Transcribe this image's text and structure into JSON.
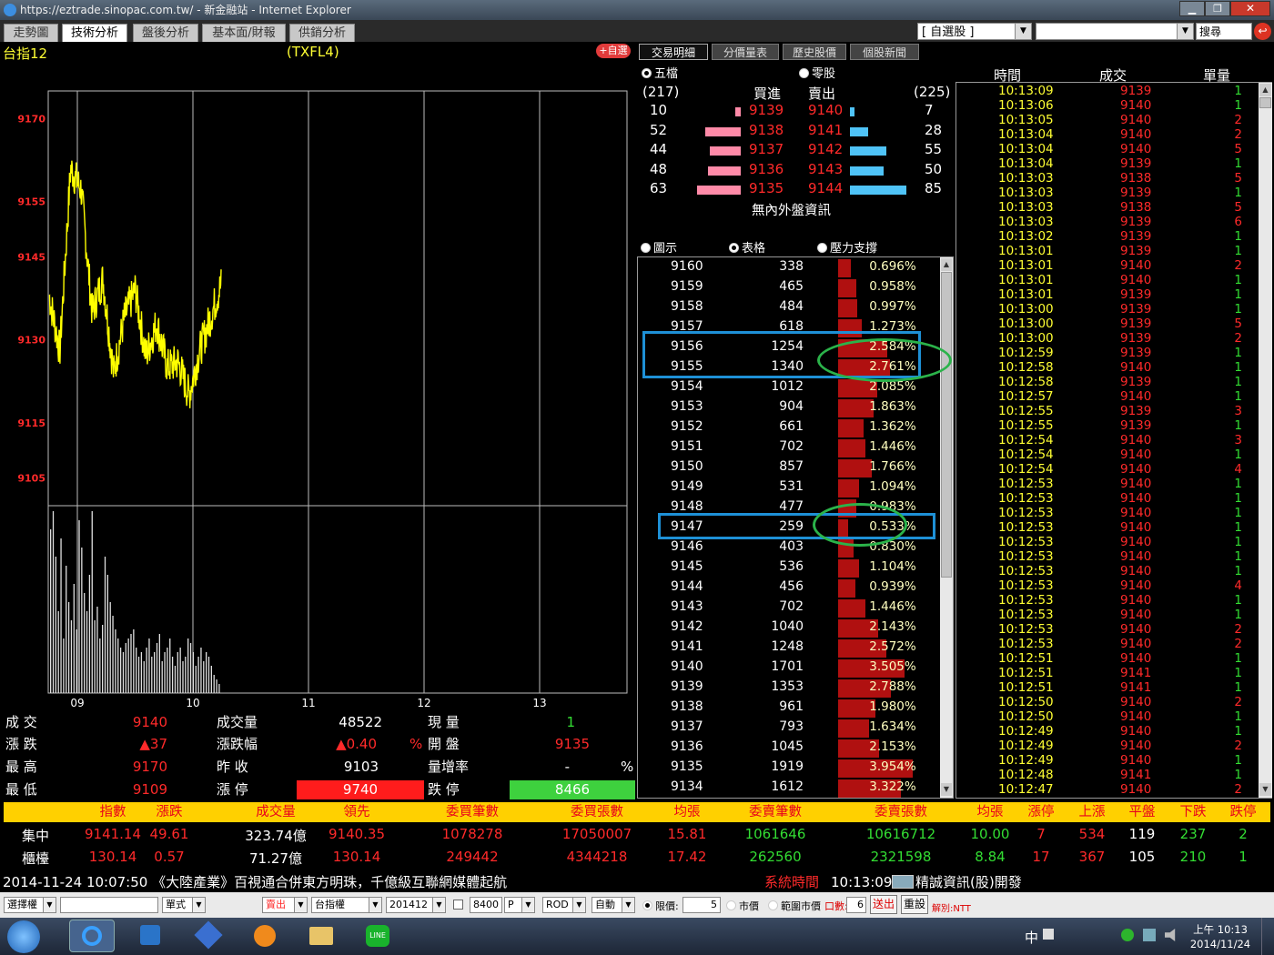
{
  "window": {
    "url": "https://eztrade.sinopac.com.tw/ - 新金融站 - Internet Explorer",
    "watchlist": "[ 自選股 ]",
    "search_label": "搜尋"
  },
  "tabs": [
    "走勢圖",
    "技術分析",
    "盤後分析",
    "基本面/財報",
    "供銷分析"
  ],
  "active_tab": 1,
  "sub_tabs": [
    "交易明細",
    "分價量表",
    "歷史股價",
    "個股新聞"
  ],
  "add_fav": "+自選",
  "chart": {
    "symbol": "台指12",
    "code": "(TXFL4)",
    "y_ticks": [
      "9170",
      "9155",
      "9145",
      "9130",
      "9115",
      "9105"
    ],
    "x_ticks": [
      "09",
      "10",
      "11",
      "12",
      "13"
    ],
    "line_color": "#ffff00",
    "ylim": [
      9100,
      9175
    ]
  },
  "chart_data": {
    "type": "line",
    "x": [
      "08:45",
      "09:00",
      "09:05",
      "09:10",
      "09:15",
      "09:20",
      "09:25",
      "09:30",
      "09:35",
      "09:40",
      "09:45",
      "09:50",
      "09:55",
      "10:00",
      "10:05",
      "10:10",
      "10:13"
    ],
    "series": [
      {
        "values": [
          9138,
          9128,
          9161,
          9157,
          9135,
          9141,
          9124,
          9134,
          9139,
          9127,
          9133,
          9125,
          9126,
          9120,
          9128,
          9134,
          9140
        ]
      }
    ],
    "ylim": [
      9100,
      9175
    ]
  },
  "volume_bars": [
    180,
    200,
    150,
    90,
    170,
    60,
    140,
    100,
    80,
    120,
    70,
    190,
    160,
    110,
    90,
    130,
    200,
    80,
    95,
    60,
    75,
    150,
    130,
    100,
    85,
    70,
    60,
    50,
    45,
    55,
    60,
    65,
    70,
    50,
    40,
    45,
    35,
    50,
    60,
    40,
    45,
    55,
    65,
    35,
    45,
    50,
    60,
    40,
    30,
    45,
    50,
    35,
    40,
    60,
    55,
    45,
    30,
    40,
    50,
    35,
    45,
    40,
    30,
    20,
    15,
    10
  ],
  "quote": {
    "labels": {
      "deal": "成 交",
      "change": "漲 跌",
      "high": "最 高",
      "low": "最 低",
      "volume": "成交量",
      "pct": "漲跌幅",
      "prev": "昨 收",
      "limit_up": "漲 停",
      "qty": "現 量",
      "open": "開 盤",
      "vol_ratio": "量增率",
      "limit_down": "跌 停"
    },
    "deal": "9140",
    "change": "▲37",
    "high": "9170",
    "low": "9109",
    "volume": "48522",
    "pct": "▲0.40",
    "pct_unit": "%",
    "prev": "9103",
    "limit_up": "9740",
    "qty": "1",
    "open": "9135",
    "vol_ratio": "-",
    "vol_ratio_unit": "%",
    "limit_down": "8466"
  },
  "orderbook": {
    "radio_five": "五檔",
    "radio_odd": "零股",
    "bid_label": "買進",
    "ask_label": "賣出",
    "bid_total": "(217)",
    "ask_total": "(225)",
    "rows": [
      {
        "bid_qty": "10",
        "bid": "9139",
        "ask": "9140",
        "ask_qty": "7",
        "bid_w": 0.13,
        "ask_w": 0.08
      },
      {
        "bid_qty": "52",
        "bid": "9138",
        "ask": "9141",
        "ask_qty": "28",
        "bid_w": 0.82,
        "ask_w": 0.33
      },
      {
        "bid_qty": "44",
        "bid": "9137",
        "ask": "9142",
        "ask_qty": "55",
        "bid_w": 0.7,
        "ask_w": 0.65
      },
      {
        "bid_qty": "48",
        "bid": "9136",
        "ask": "9143",
        "ask_qty": "50",
        "bid_w": 0.76,
        "ask_w": 0.59
      },
      {
        "bid_qty": "63",
        "bid": "9135",
        "ask": "9144",
        "ask_qty": "85",
        "bid_w": 1.0,
        "ask_w": 1.0
      }
    ],
    "note": "無內外盤資訊"
  },
  "volume_table": {
    "radio_chart": "圖示",
    "radio_table": "表格",
    "radio_support": "壓力支撐",
    "rows": [
      {
        "price": "9160",
        "vol": "338",
        "pct": "0.696%"
      },
      {
        "price": "9159",
        "vol": "465",
        "pct": "0.958%"
      },
      {
        "price": "9158",
        "vol": "484",
        "pct": "0.997%"
      },
      {
        "price": "9157",
        "vol": "618",
        "pct": "1.273%"
      },
      {
        "price": "9156",
        "vol": "1254",
        "pct": "2.584%"
      },
      {
        "price": "9155",
        "vol": "1340",
        "pct": "2.761%"
      },
      {
        "price": "9154",
        "vol": "1012",
        "pct": "2.085%"
      },
      {
        "price": "9153",
        "vol": "904",
        "pct": "1.863%"
      },
      {
        "price": "9152",
        "vol": "661",
        "pct": "1.362%"
      },
      {
        "price": "9151",
        "vol": "702",
        "pct": "1.446%"
      },
      {
        "price": "9150",
        "vol": "857",
        "pct": "1.766%"
      },
      {
        "price": "9149",
        "vol": "531",
        "pct": "1.094%"
      },
      {
        "price": "9148",
        "vol": "477",
        "pct": "0.983%"
      },
      {
        "price": "9147",
        "vol": "259",
        "pct": "0.533%"
      },
      {
        "price": "9146",
        "vol": "403",
        "pct": "0.830%"
      },
      {
        "price": "9145",
        "vol": "536",
        "pct": "1.104%"
      },
      {
        "price": "9144",
        "vol": "456",
        "pct": "0.939%"
      },
      {
        "price": "9143",
        "vol": "702",
        "pct": "1.446%"
      },
      {
        "price": "9142",
        "vol": "1040",
        "pct": "2.143%"
      },
      {
        "price": "9141",
        "vol": "1248",
        "pct": "2.572%"
      },
      {
        "price": "9140",
        "vol": "1701",
        "pct": "3.505%"
      },
      {
        "price": "9139",
        "vol": "1353",
        "pct": "2.788%"
      },
      {
        "price": "9138",
        "vol": "961",
        "pct": "1.980%"
      },
      {
        "price": "9137",
        "vol": "793",
        "pct": "1.634%"
      },
      {
        "price": "9136",
        "vol": "1045",
        "pct": "2.153%"
      },
      {
        "price": "9135",
        "vol": "1919",
        "pct": "3.954%"
      },
      {
        "price": "9134",
        "vol": "1612",
        "pct": "3.322%"
      }
    ]
  },
  "trades": {
    "headers": [
      "時間",
      "成交",
      "單量"
    ],
    "rows": [
      [
        "10:13:09",
        "9139",
        "1"
      ],
      [
        "10:13:06",
        "9140",
        "1"
      ],
      [
        "10:13:05",
        "9140",
        "2"
      ],
      [
        "10:13:04",
        "9140",
        "2"
      ],
      [
        "10:13:04",
        "9140",
        "5"
      ],
      [
        "10:13:04",
        "9139",
        "1"
      ],
      [
        "10:13:03",
        "9138",
        "5"
      ],
      [
        "10:13:03",
        "9139",
        "1"
      ],
      [
        "10:13:03",
        "9138",
        "5"
      ],
      [
        "10:13:03",
        "9139",
        "6"
      ],
      [
        "10:13:02",
        "9139",
        "1"
      ],
      [
        "10:13:01",
        "9139",
        "1"
      ],
      [
        "10:13:01",
        "9140",
        "2"
      ],
      [
        "10:13:01",
        "9140",
        "1"
      ],
      [
        "10:13:01",
        "9139",
        "1"
      ],
      [
        "10:13:00",
        "9139",
        "1"
      ],
      [
        "10:13:00",
        "9139",
        "5"
      ],
      [
        "10:13:00",
        "9139",
        "2"
      ],
      [
        "10:12:59",
        "9139",
        "1"
      ],
      [
        "10:12:58",
        "9140",
        "1"
      ],
      [
        "10:12:58",
        "9139",
        "1"
      ],
      [
        "10:12:57",
        "9140",
        "1"
      ],
      [
        "10:12:55",
        "9139",
        "3"
      ],
      [
        "10:12:55",
        "9139",
        "1"
      ],
      [
        "10:12:54",
        "9140",
        "3"
      ],
      [
        "10:12:54",
        "9140",
        "1"
      ],
      [
        "10:12:54",
        "9140",
        "4"
      ],
      [
        "10:12:53",
        "9140",
        "1"
      ],
      [
        "10:12:53",
        "9140",
        "1"
      ],
      [
        "10:12:53",
        "9140",
        "1"
      ],
      [
        "10:12:53",
        "9140",
        "1"
      ],
      [
        "10:12:53",
        "9140",
        "1"
      ],
      [
        "10:12:53",
        "9140",
        "1"
      ],
      [
        "10:12:53",
        "9140",
        "1"
      ],
      [
        "10:12:53",
        "9140",
        "4"
      ],
      [
        "10:12:53",
        "9140",
        "1"
      ],
      [
        "10:12:53",
        "9140",
        "1"
      ],
      [
        "10:12:53",
        "9140",
        "2"
      ],
      [
        "10:12:53",
        "9140",
        "2"
      ],
      [
        "10:12:51",
        "9140",
        "1"
      ],
      [
        "10:12:51",
        "9141",
        "1"
      ],
      [
        "10:12:51",
        "9141",
        "1"
      ],
      [
        "10:12:50",
        "9140",
        "2"
      ],
      [
        "10:12:50",
        "9140",
        "1"
      ],
      [
        "10:12:49",
        "9140",
        "1"
      ],
      [
        "10:12:49",
        "9140",
        "2"
      ],
      [
        "10:12:49",
        "9140",
        "1"
      ],
      [
        "10:12:48",
        "9141",
        "1"
      ],
      [
        "10:12:47",
        "9140",
        "2"
      ]
    ]
  },
  "market": {
    "headers": [
      "指數",
      "漲跌",
      "成交量",
      "領先",
      "委買筆數",
      "委買張數",
      "均張",
      "委賣筆數",
      "委賣張數",
      "均張",
      "漲停",
      "上漲",
      "平盤",
      "下跌",
      "跌停"
    ],
    "rows": [
      {
        "name": "集中",
        "cells": [
          "9141.14",
          "49.61",
          "323.74億",
          "9140.35",
          "1078278",
          "17050007",
          "15.81",
          "1061646",
          "10616712",
          "10.00",
          "7",
          "534",
          "119",
          "237",
          "2"
        ]
      },
      {
        "name": "櫃檯",
        "cells": [
          "130.14",
          "0.57",
          "71.27億",
          "130.14",
          "249442",
          "4344218",
          "17.42",
          "262560",
          "2321598",
          "8.84",
          "17",
          "367",
          "105",
          "210",
          "1"
        ]
      }
    ]
  },
  "news": {
    "text": "2014-11-24 10:07:50 《大陸產業》百視通合併東方明珠，千億級互聯網媒體起航",
    "sys_label": "系統時間",
    "sys_time": "10:13:09",
    "source": "精誠資訊(股)開發"
  },
  "order": {
    "product": "選擇權",
    "type": "單式",
    "side": "賣出",
    "underlying": "台指權",
    "month": "201412",
    "strike": "8400",
    "cp": "P",
    "cond": "ROD",
    "mode": "自動",
    "limit_label": "限價:",
    "qty": "5",
    "market_label": "市價",
    "range_label": "範圍市價",
    "lots_label": "口數:",
    "lots": "6",
    "send": "送出",
    "reset": "重設",
    "account": "解別:NTT"
  },
  "taskbar": {
    "ime": "中",
    "time": "上午 10:13",
    "date": "2014/11/24"
  }
}
